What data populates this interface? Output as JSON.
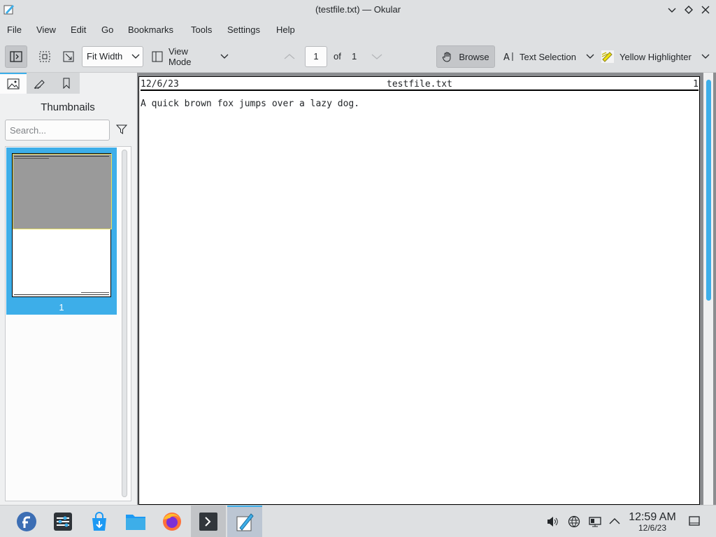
{
  "window": {
    "title": "(testfile.txt) — Okular"
  },
  "menu": [
    "File",
    "Edit",
    "View",
    "Go",
    "Bookmarks",
    "Tools",
    "Settings",
    "Help"
  ],
  "toolbar": {
    "zoom_value": "Fit Width",
    "view_mode_label": "View Mode",
    "page_current": "1",
    "page_of_label": "of",
    "page_total": "1",
    "browse_label": "Browse",
    "text_selection_label": "Text Selection",
    "highlighter_label": "Yellow Highlighter"
  },
  "sidebar": {
    "panel_title": "Thumbnails",
    "search_placeholder": "Search...",
    "thumbnails": [
      {
        "page_label": "1",
        "selected": true
      }
    ]
  },
  "document": {
    "header_left": "12/6/23",
    "header_center": "testfile.txt",
    "header_right": "1",
    "body_text": "A quick brown fox jumps over a lazy dog."
  },
  "taskbar": {
    "apps": [
      "fedora-launcher-icon",
      "system-settings-icon",
      "discover-store-icon",
      "file-manager-icon",
      "firefox-icon",
      "terminal-icon",
      "okular-icon"
    ],
    "active_app": "okular-icon",
    "tray_icons": [
      "volume-icon",
      "network-icon",
      "display-icon",
      "expand-tray-icon"
    ],
    "time": "12:59 AM",
    "date": "12/6/23"
  },
  "colors": {
    "accent": "#3daee9",
    "highlight": "#f1e30f",
    "chrome": "#dee0e2"
  }
}
